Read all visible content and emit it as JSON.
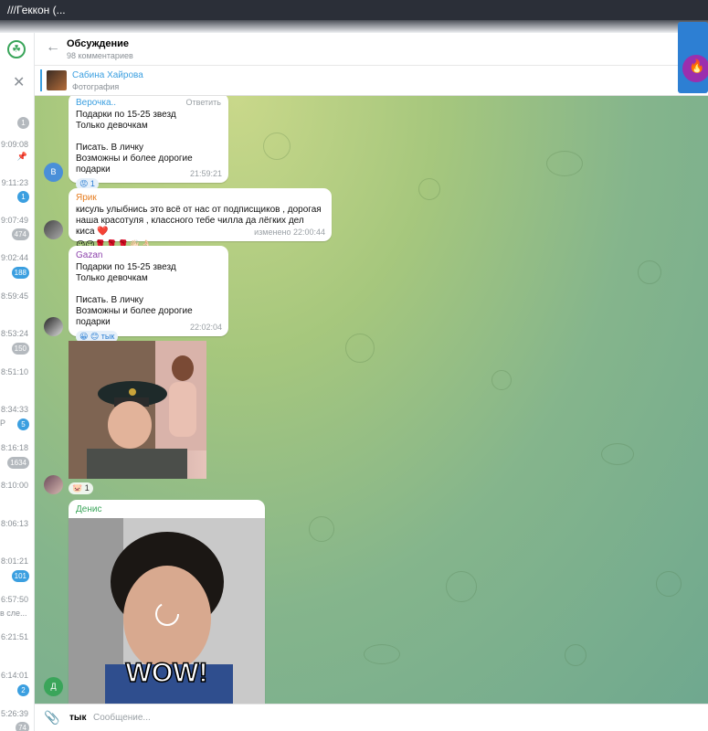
{
  "window": {
    "title": "///Геккон (..."
  },
  "header": {
    "title": "Обсуждение",
    "subtitle": "98 комментариев"
  },
  "pinned": {
    "name": "Сабина Хайрова",
    "text": "Фотография"
  },
  "left_list": [
    {
      "time": "",
      "badge": "1",
      "badge_style": "grey"
    },
    {
      "time": "9:09:08",
      "badge": "",
      "pinned": true
    },
    {
      "time": "9:11:23",
      "badge": "1",
      "badge_style": "blue"
    },
    {
      "time": "9:07:49",
      "badge": "474",
      "badge_style": "grey"
    },
    {
      "time": "9:02:44",
      "badge": "188",
      "badge_style": "blue"
    },
    {
      "time": "8:59:45",
      "badge": ""
    },
    {
      "time": "8:53:24",
      "badge": "150",
      "badge_style": "grey"
    },
    {
      "time": "8:51:10",
      "badge": ""
    },
    {
      "time": "8:34:33",
      "badge": "5",
      "badge_style": "blue",
      "snippet": "Р"
    },
    {
      "time": "8:16:18",
      "badge": "1634",
      "badge_style": "grey"
    },
    {
      "time": "8:10:00",
      "badge": ""
    },
    {
      "time": "8:06:13",
      "badge": ""
    },
    {
      "time": "8:01:21",
      "badge": "101",
      "badge_style": "blue"
    },
    {
      "time": "6:57:50",
      "badge": "",
      "snippet": "в сле..."
    },
    {
      "time": "6:21:51",
      "badge": ""
    },
    {
      "time": "6:14:01",
      "badge": "2",
      "badge_style": "blue"
    },
    {
      "time": "5:26:39",
      "badge": "74",
      "badge_style": "grey"
    }
  ],
  "messages": [
    {
      "sender": "Верочка..",
      "sender_color": "#3b9fe0",
      "reply_label": "Ответить",
      "text": "Подарки по 15-25 звезд\nТолько девочкам\n\nПисать. В личку\nВозможны и более дорогие подарки",
      "reaction": "😡 1",
      "time": "21:59:21",
      "avatar_letter": "В",
      "avatar_color": "#4a8fd8"
    },
    {
      "sender": "Ярик",
      "sender_color": "#e67e22",
      "text": "кисуль улыбнись это всё от нас от подписщиков , дорогая наша красотуля , классного тебе чилла да лёгких дел киса ❤️",
      "reaction": "😉😉🌹🌹🌹👋🏻👌🏻",
      "time": "изменено 22:00:44"
    },
    {
      "sender": "Gazan",
      "sender_color": "#8e44ad",
      "text": "Подарки по 15-25 звезд\nТолько девочкам\n\nПисать. В личку\nВозможны и более дорогие подарки",
      "reaction": "😀 😊 тык",
      "time": "22:02:04"
    },
    {
      "type": "photo",
      "reaction": "🐷 1"
    },
    {
      "sender": "Денис",
      "sender_color": "#3aa55a",
      "type": "gif",
      "caption": "WOW!",
      "avatar_letter": "Д",
      "avatar_color": "#3aa55a"
    }
  ],
  "composer": {
    "draft": "тык",
    "placeholder": "Сообщение..."
  },
  "icons": [
    "logo-icon",
    "close-icon",
    "back-arrow-icon",
    "pin-icon",
    "attach-icon",
    "loading-spinner-icon",
    "app-icon"
  ]
}
